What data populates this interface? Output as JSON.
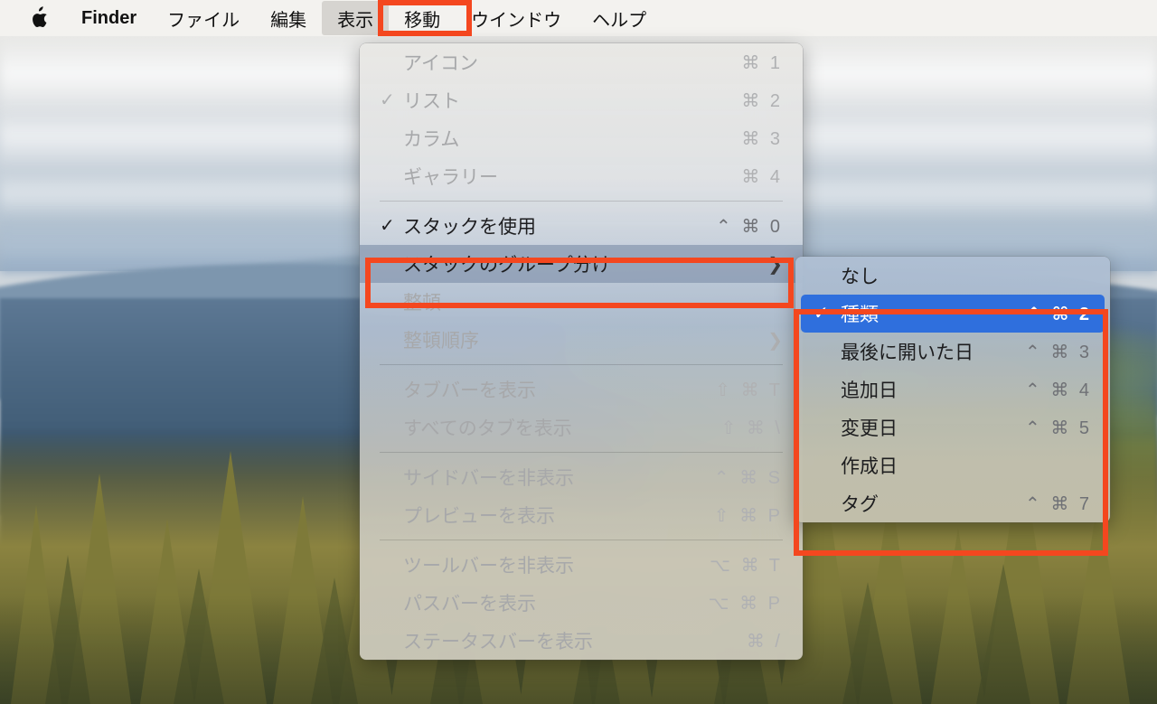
{
  "menubar": {
    "apple_icon": "apple-logo-icon",
    "items": [
      {
        "label": "Finder",
        "bold": true,
        "active": false
      },
      {
        "label": "ファイル",
        "bold": false,
        "active": false
      },
      {
        "label": "編集",
        "bold": false,
        "active": false
      },
      {
        "label": "表示",
        "bold": false,
        "active": true
      },
      {
        "label": "移動",
        "bold": false,
        "active": false
      },
      {
        "label": "ウインドウ",
        "bold": false,
        "active": false
      },
      {
        "label": "ヘルプ",
        "bold": false,
        "active": false
      }
    ]
  },
  "view_menu": {
    "title": "表示",
    "items": [
      {
        "label": "アイコン",
        "shortcut": "⌘ 1",
        "checked": false,
        "dimmed": true,
        "submenu": false,
        "selected": false
      },
      {
        "label": "リスト",
        "shortcut": "⌘ 2",
        "checked": true,
        "dimmed": true,
        "submenu": false,
        "selected": false
      },
      {
        "label": "カラム",
        "shortcut": "⌘ 3",
        "checked": false,
        "dimmed": true,
        "submenu": false,
        "selected": false
      },
      {
        "label": "ギャラリー",
        "shortcut": "⌘ 4",
        "checked": false,
        "dimmed": true,
        "submenu": false,
        "selected": false
      },
      {
        "separator": true
      },
      {
        "label": "スタックを使用",
        "shortcut": "⌃ ⌘ 0",
        "checked": true,
        "dimmed": false,
        "submenu": false,
        "selected": false
      },
      {
        "label": "スタックのグループ分け",
        "shortcut": "",
        "checked": false,
        "dimmed": false,
        "submenu": true,
        "selected": true
      },
      {
        "label": "整頓",
        "shortcut": "",
        "checked": false,
        "dimmed": true,
        "submenu": false,
        "selected": false
      },
      {
        "label": "整頓順序",
        "shortcut": "",
        "checked": false,
        "dimmed": true,
        "submenu": true,
        "selected": false
      },
      {
        "separator": true
      },
      {
        "label": "タブバーを表示",
        "shortcut": "⇧ ⌘ T",
        "checked": false,
        "dimmed": true,
        "submenu": false,
        "selected": false
      },
      {
        "label": "すべてのタブを表示",
        "shortcut": "⇧ ⌘ \\",
        "checked": false,
        "dimmed": true,
        "submenu": false,
        "selected": false
      },
      {
        "separator": true
      },
      {
        "label": "サイドバーを非表示",
        "shortcut": "⌃ ⌘ S",
        "checked": false,
        "dimmed": true,
        "submenu": false,
        "selected": false
      },
      {
        "label": "プレビューを表示",
        "shortcut": "⇧ ⌘ P",
        "checked": false,
        "dimmed": true,
        "submenu": false,
        "selected": false
      },
      {
        "separator": true
      },
      {
        "label": "ツールバーを非表示",
        "shortcut": "⌥ ⌘ T",
        "checked": false,
        "dimmed": true,
        "submenu": false,
        "selected": false
      },
      {
        "label": "パスバーを表示",
        "shortcut": "⌥ ⌘ P",
        "checked": false,
        "dimmed": true,
        "submenu": false,
        "selected": false
      },
      {
        "label": "ステータスバーを表示",
        "shortcut": "⌘ /",
        "checked": false,
        "dimmed": true,
        "submenu": false,
        "selected": false
      }
    ]
  },
  "stack_group_submenu": {
    "items": [
      {
        "label": "なし",
        "shortcut": "",
        "checked": false,
        "highlighted": false
      },
      {
        "label": "種類",
        "shortcut": "⌃ ⌘ 2",
        "checked": true,
        "highlighted": true
      },
      {
        "label": "最後に開いた日",
        "shortcut": "⌃ ⌘ 3",
        "checked": false,
        "highlighted": false
      },
      {
        "label": "追加日",
        "shortcut": "⌃ ⌘ 4",
        "checked": false,
        "highlighted": false
      },
      {
        "label": "変更日",
        "shortcut": "⌃ ⌘ 5",
        "checked": false,
        "highlighted": false
      },
      {
        "label": "作成日",
        "shortcut": "",
        "checked": false,
        "highlighted": false
      },
      {
        "label": "タグ",
        "shortcut": "⌃ ⌘ 7",
        "checked": false,
        "highlighted": false
      }
    ]
  },
  "annotations": {
    "highlight_color": "#f4471f",
    "boxes": [
      {
        "name": "view-menu-title",
        "target": "表示"
      },
      {
        "name": "stack-grouping-row",
        "target": "スタックのグループ分け"
      },
      {
        "name": "grouping-options",
        "target": "種類 / 最後に開いた日 / 追加日 / 変更日 / 作成日 / タグ"
      }
    ]
  },
  "glyphs": {
    "check": "✓",
    "submenu_arrow": "❯"
  }
}
